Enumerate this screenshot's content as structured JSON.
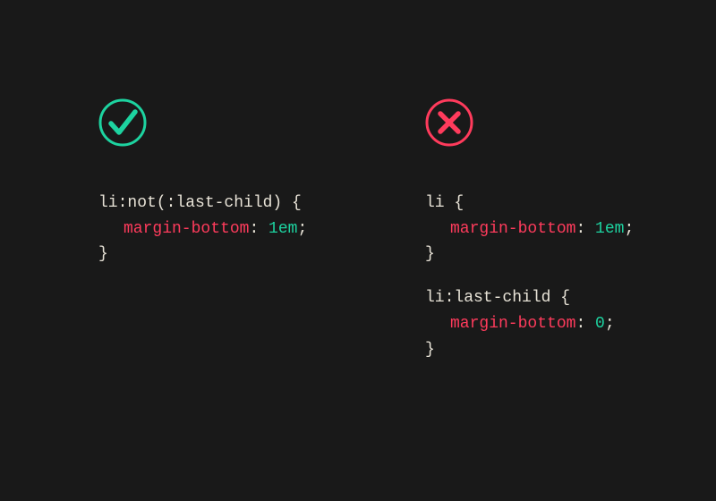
{
  "colors": {
    "success": "#1dd3a0",
    "error": "#ff3b5c",
    "selector": "#e8e3d7",
    "property": "#ff3b5c",
    "value": "#1dd3a0",
    "background": "#191919"
  },
  "left": {
    "status": "correct",
    "block1": {
      "selector": "li:not(:last-child)",
      "prop": "margin-bottom",
      "value": "1em"
    }
  },
  "right": {
    "status": "incorrect",
    "block1": {
      "selector": "li",
      "prop": "margin-bottom",
      "value": "1em"
    },
    "block2": {
      "selector": "li:last-child",
      "prop": "margin-bottom",
      "value": "0"
    }
  }
}
